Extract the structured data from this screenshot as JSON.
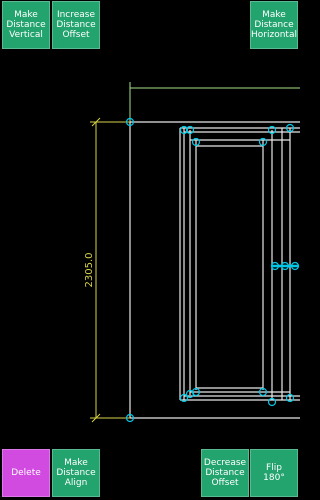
{
  "toolbar_top": {
    "make_distance_vertical": "Make\nDistance\nVertical",
    "increase_distance_offset": "Increase\nDistance\nOffset",
    "make_distance_horizontal": "Make\nDistance\nHorizontal"
  },
  "toolbar_bottom": {
    "delete": "Delete",
    "make_distance_align": "Make\nDistance\nAlign",
    "decrease_distance_offset": "Decrease\nDistance\nOffset",
    "flip_180": "Flip\n180°"
  },
  "drawing": {
    "dimension_label": "2305.0"
  },
  "colors": {
    "background": "#000000",
    "wall_lines": "#e8e8e8",
    "dimension_line": "#d6d24a",
    "snap_handles": "#00c8e6",
    "green_button": "#23a36e",
    "magenta_button": "#d14be0"
  }
}
